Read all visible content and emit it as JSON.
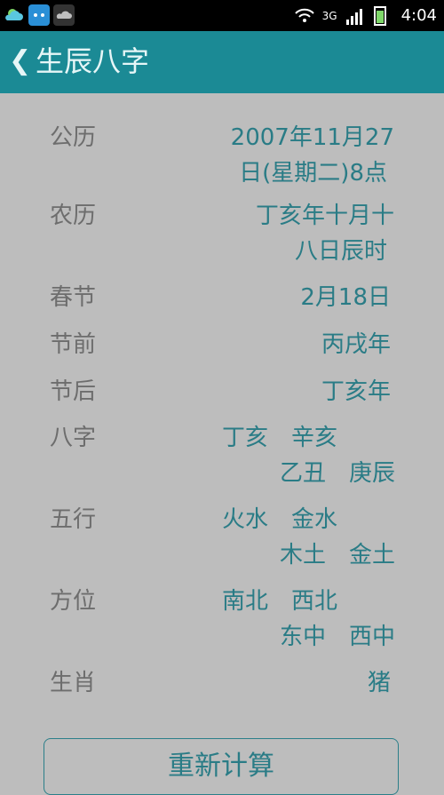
{
  "status_bar": {
    "time": "4:04",
    "network": "3G",
    "icons": [
      "weather-icon",
      "baidu-app-icon",
      "cloud-icon",
      "wifi-icon",
      "signal-icon",
      "battery-icon"
    ]
  },
  "app_bar": {
    "back_icon": "back-chevron-icon",
    "title": "生辰八字"
  },
  "rows": [
    {
      "label": "公历",
      "value_line1": "2007年11月27",
      "value_line2": "日(星期二)8点"
    },
    {
      "label": "农历",
      "value_line1": "丁亥年十月十",
      "value_line2": "八日辰时"
    },
    {
      "label": "春节",
      "value": "2月18日"
    },
    {
      "label": "节前",
      "value": "丙戌年"
    },
    {
      "label": "节后",
      "value": "丁亥年"
    },
    {
      "label": "八字",
      "value_line1": "丁亥　辛亥",
      "value_line2": "乙丑　庚辰"
    },
    {
      "label": "五行",
      "value_line1": "火水　金水",
      "value_line2": "木土　金土"
    },
    {
      "label": "方位",
      "value_line1": "南北　西北",
      "value_line2": "东中　西中"
    },
    {
      "label": "生肖",
      "value": "猪"
    }
  ],
  "button": {
    "label": "重新计算"
  },
  "colors": {
    "app_bar": "#1b8a95",
    "value_text": "#2a7c86",
    "label_text": "#6d6d6d",
    "background": "#bdbdbd"
  }
}
